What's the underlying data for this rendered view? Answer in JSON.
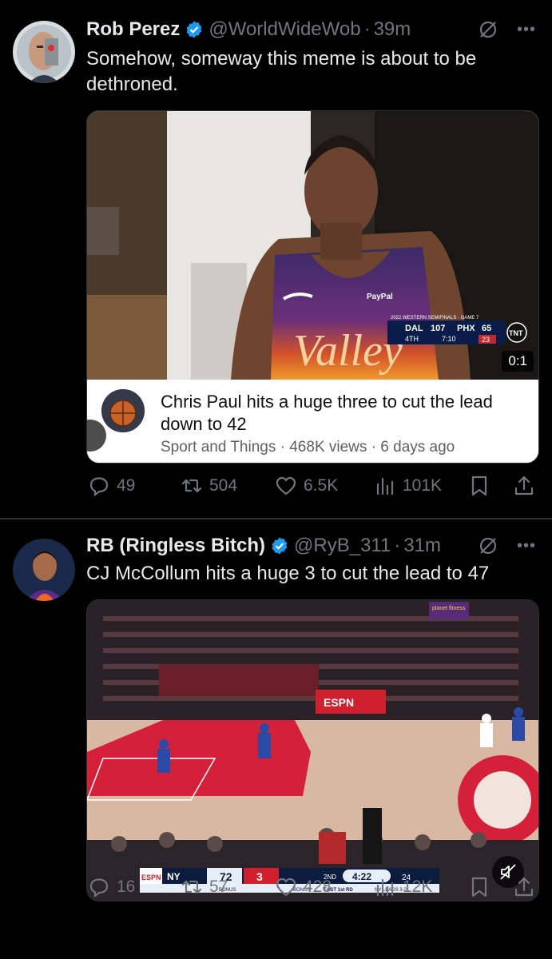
{
  "colors": {
    "background": "#000000",
    "text": "#e7e9ea",
    "muted": "#71767b",
    "verified": "#1d9bf0",
    "separator": "#2f3336"
  },
  "tweets": [
    {
      "author": {
        "display_name": "Rob Perez",
        "handle": "@WorldWideWob",
        "avatar_icon": "robot-face-avatar",
        "verified": true
      },
      "dot": "·",
      "time": "39m",
      "text": "Somehow, someway this meme is about to be dethroned.",
      "media": {
        "type": "youtube-card",
        "scoreboard": {
          "title": "2022 WESTERN SEMIFINALS · GAME 7",
          "team1": "DAL",
          "score1": "107",
          "team2": "PHX",
          "score2": "65",
          "period": "4TH",
          "clock": "7:10",
          "shot_clock": "23",
          "network": "TNT"
        },
        "jersey_text": "Valley",
        "duration": "0:1",
        "caption_title": "Chris Paul hits a huge three to cut the lead down to 42",
        "caption_meta": "Sport and Things · 468K views · 6 days ago"
      },
      "stats": {
        "replies": "49",
        "reposts": "504",
        "likes": "6.5K",
        "views": "101K"
      }
    },
    {
      "author": {
        "display_name": "RB (Ringless Bitch)",
        "handle": "@RyB_311",
        "avatar_icon": "player-avatar",
        "verified": true
      },
      "dot": "·",
      "time": "31m",
      "text": "CJ McCollum hits a huge 3 to cut the lead to 47",
      "media": {
        "type": "video",
        "network": "ESPN",
        "scoreboard": {
          "team1": "NY",
          "score1": "72",
          "score2": "3",
          "period": "2ND",
          "clock": "4:22",
          "shot_clock": "24",
          "bonus_left": "BONUS",
          "bonus_right": "BONUS",
          "series": "EAST 1st RD",
          "series_status": "NY LEADS 3-2"
        },
        "arena_sign": "planet fitness"
      },
      "stats": {
        "replies": "16",
        "reposts": "57",
        "likes": "428",
        "views": "12K"
      }
    }
  ]
}
